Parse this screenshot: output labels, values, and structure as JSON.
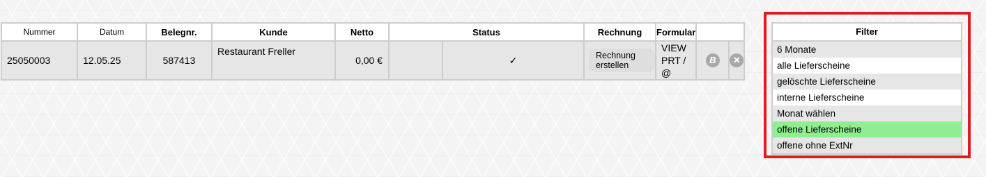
{
  "table": {
    "headers": {
      "nummer": "Nummer",
      "datum": "Datum",
      "belegnr": "Belegnr.",
      "kunde": "Kunde",
      "netto": "Netto",
      "status": "Status",
      "rechnung": "Rechnung",
      "formular": "Formular"
    },
    "row": {
      "nummer": "25050003",
      "datum": "12.05.25",
      "belegnr": "587413",
      "kunde": "Restaurant Freller",
      "netto": "0,00 €",
      "status": "✓",
      "rechnung_button": "Rechnung erstellen",
      "formular_line1": "VIEW",
      "formular_line2": "PRT / @",
      "b_icon": "B",
      "delete_icon": "✕"
    }
  },
  "filter": {
    "title": "Filter",
    "items": [
      "6 Monate",
      "alle Lieferscheine",
      "gelöschte Lieferscheine",
      "interne Lieferscheine",
      "Monat wählen",
      "offene Lieferscheine",
      "offene ohne ExtNr"
    ],
    "selected": "offene Lieferscheine",
    "highlight_color": "#90ee90",
    "frame_color": "#e01b1b"
  }
}
